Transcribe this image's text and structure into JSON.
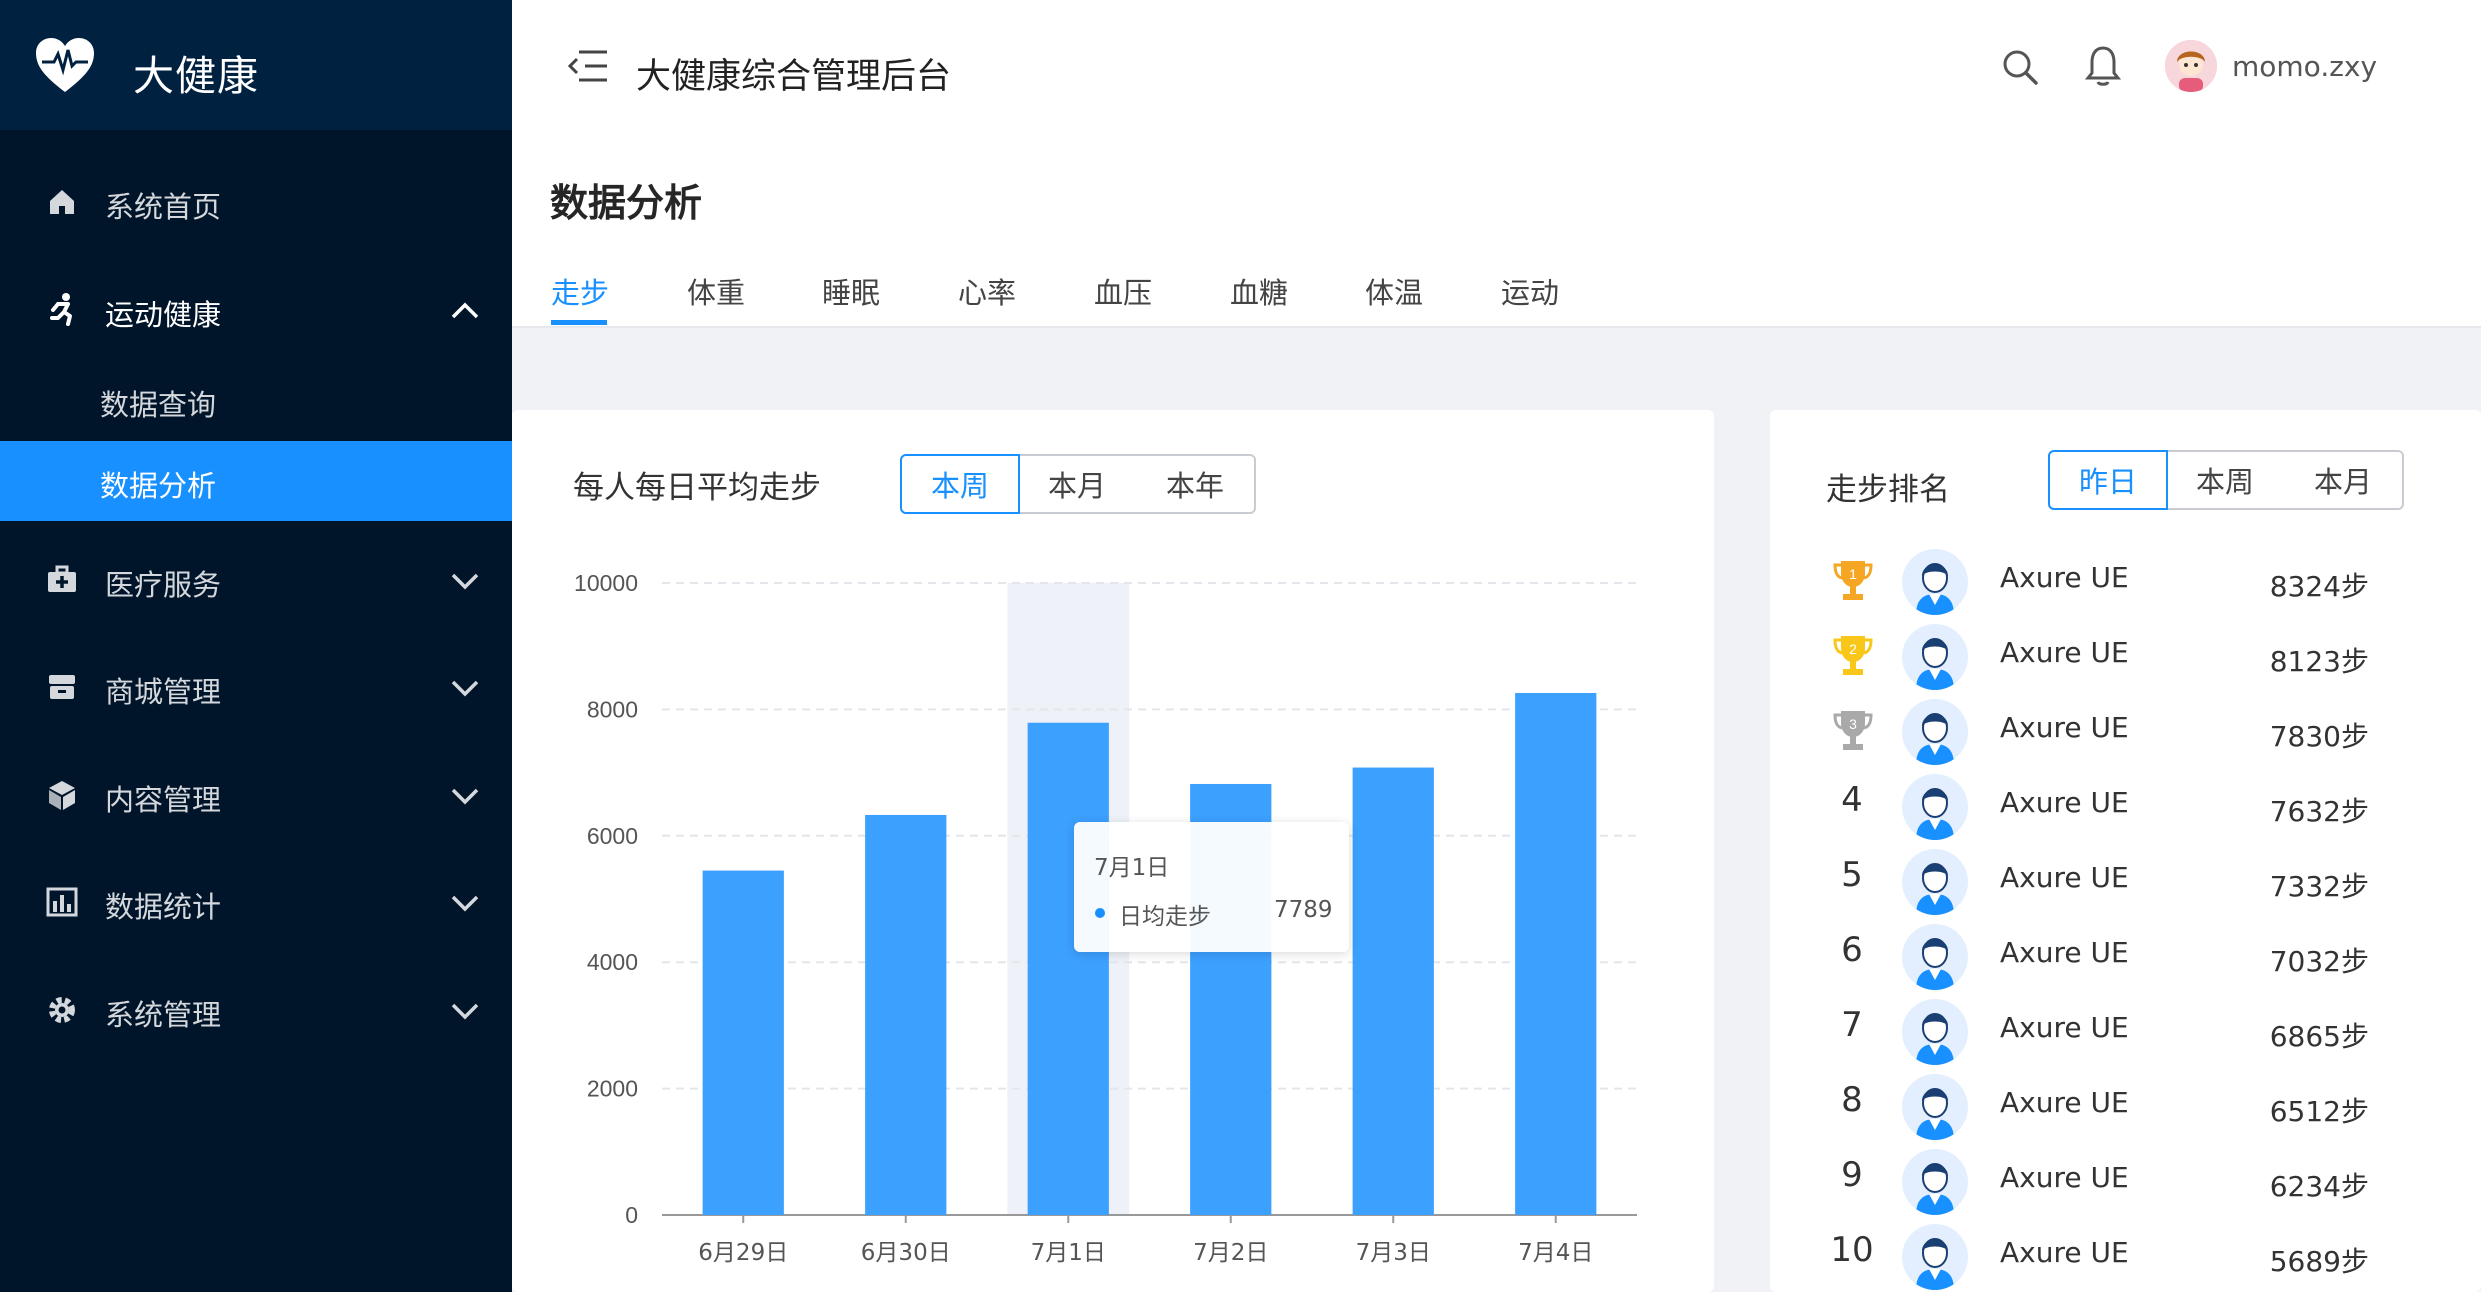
{
  "app": {
    "logo_text": "大健康",
    "system_title": "大健康综合管理后台",
    "username": "momo.zxy"
  },
  "sidebar": {
    "items": [
      {
        "label": "系统首页",
        "icon": "home-icon"
      },
      {
        "label": "运动健康",
        "icon": "running-icon",
        "expanded": true,
        "children": [
          {
            "label": "数据查询"
          },
          {
            "label": "数据分析",
            "selected": true
          }
        ]
      },
      {
        "label": "医疗服务",
        "icon": "medical-kit-icon"
      },
      {
        "label": "商城管理",
        "icon": "store-icon"
      },
      {
        "label": "内容管理",
        "icon": "cube-icon"
      },
      {
        "label": "数据统计",
        "icon": "bar-chart-icon"
      },
      {
        "label": "系统管理",
        "icon": "gear-icon"
      }
    ]
  },
  "page": {
    "title": "数据分析",
    "tabs": [
      "走步",
      "体重",
      "睡眠",
      "心率",
      "血压",
      "血糖",
      "体温",
      "运动"
    ],
    "active_tab": "走步"
  },
  "chart_card": {
    "title": "每人每日平均走步",
    "segments": [
      "本周",
      "本月",
      "本年"
    ],
    "selected_segment": "本周"
  },
  "tooltip": {
    "title": "7月1日",
    "series_name": "日均走步",
    "value": "7789"
  },
  "rank_card": {
    "title": "走步排名",
    "segments": [
      "昨日",
      "本周",
      "本月"
    ],
    "selected_segment": "昨日",
    "rows": [
      {
        "rank": "1",
        "name": "Axure UE",
        "steps": "8324步",
        "trophy": "gold"
      },
      {
        "rank": "2",
        "name": "Axure UE",
        "steps": "8123步",
        "trophy": "yellow"
      },
      {
        "rank": "3",
        "name": "Axure UE",
        "steps": "7830步",
        "trophy": "silver"
      },
      {
        "rank": "4",
        "name": "Axure UE",
        "steps": "7632步"
      },
      {
        "rank": "5",
        "name": "Axure UE",
        "steps": "7332步"
      },
      {
        "rank": "6",
        "name": "Axure UE",
        "steps": "7032步"
      },
      {
        "rank": "7",
        "name": "Axure UE",
        "steps": "6865步"
      },
      {
        "rank": "8",
        "name": "Axure UE",
        "steps": "6512步"
      },
      {
        "rank": "9",
        "name": "Axure UE",
        "steps": "6234步"
      },
      {
        "rank": "10",
        "name": "Axure UE",
        "steps": "5689步"
      }
    ]
  },
  "colors": {
    "sidebar_bg": "#001529",
    "logo_bg": "#002140",
    "accent": "#1890ff",
    "bar": "#3ca0ff",
    "gold_trophy": "#f5a623",
    "yellow_trophy": "#f8c719",
    "silver_trophy": "#a9a9a9"
  },
  "chart_data": {
    "type": "bar",
    "categories": [
      "6月29日",
      "6月30日",
      "7月1日",
      "7月2日",
      "7月3日",
      "7月4日"
    ],
    "series": [
      {
        "name": "日均走步",
        "values": [
          5450,
          6330,
          7789,
          6820,
          7080,
          8260
        ]
      }
    ],
    "ylim": [
      0,
      10000
    ],
    "yticks": [
      "0",
      "2000",
      "4000",
      "6000",
      "8000",
      "10000"
    ],
    "highlighted_category": "7月1日",
    "grid": "dashed horizontal"
  }
}
